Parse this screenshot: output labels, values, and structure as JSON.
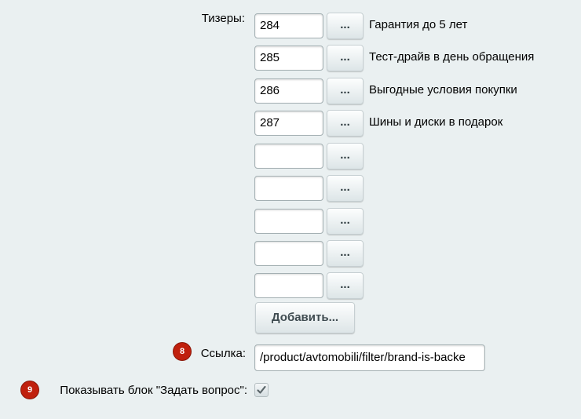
{
  "teasers": {
    "label": "Тизеры:",
    "rows": [
      {
        "id": "284",
        "name": "Гарантия до 5 лет"
      },
      {
        "id": "285",
        "name": "Тест-драйв в день обращения"
      },
      {
        "id": "286",
        "name": "Выгодные условия покупки"
      },
      {
        "id": "287",
        "name": "Шины и диски в подарок"
      },
      {
        "id": "",
        "name": ""
      },
      {
        "id": "",
        "name": ""
      },
      {
        "id": "",
        "name": ""
      },
      {
        "id": "",
        "name": ""
      },
      {
        "id": "",
        "name": ""
      }
    ],
    "browse_label": "...",
    "add_label": "Добавить..."
  },
  "link": {
    "badge": "8",
    "label": "Ссылка:",
    "value": "/product/avtomobili/filter/brand-is-backe"
  },
  "question_block": {
    "badge": "9",
    "label": "Показывать блок \"Задать вопрос\":",
    "checked": true
  }
}
